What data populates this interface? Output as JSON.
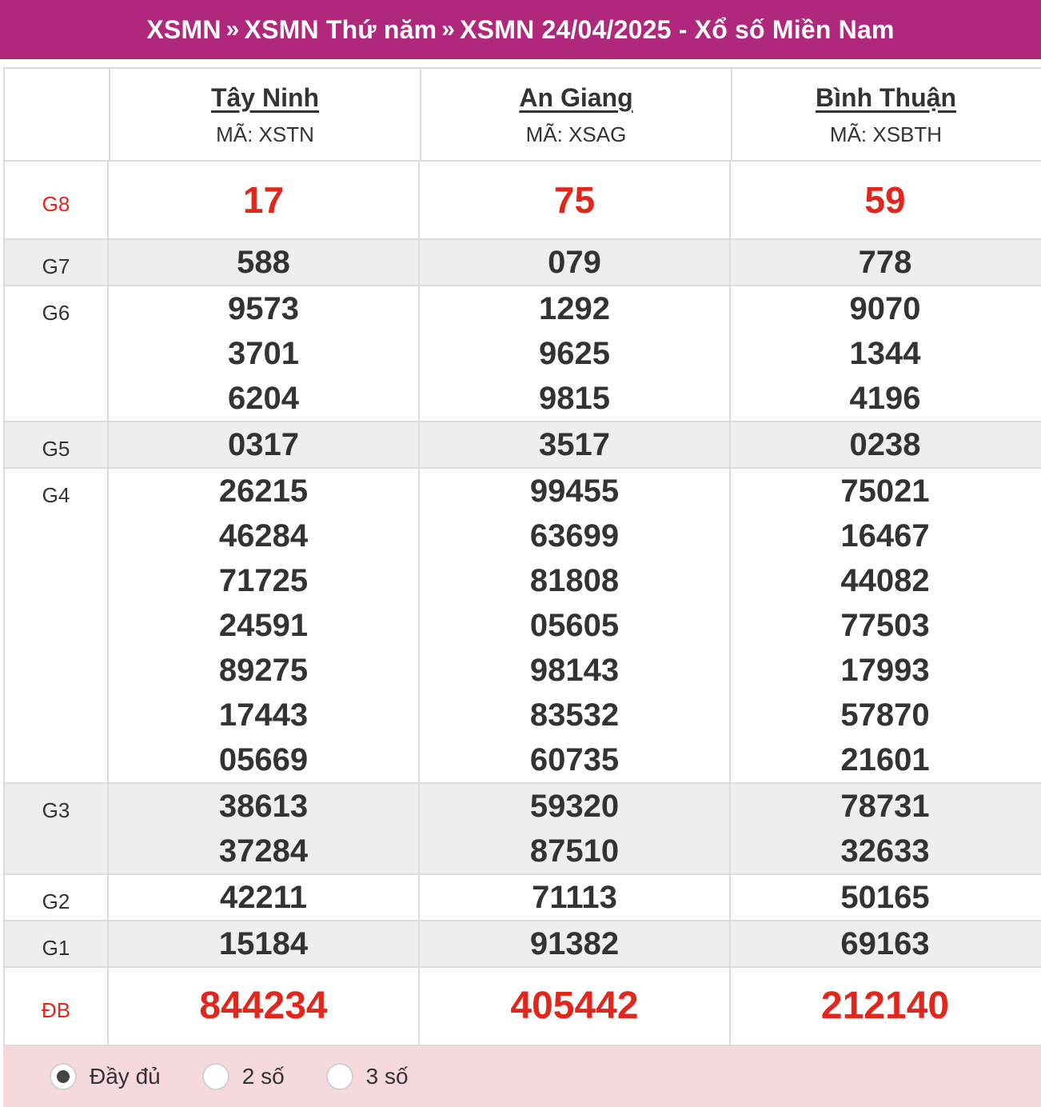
{
  "title": {
    "part1": "XSMN",
    "sep": "»",
    "part2": "XSMN Thứ năm",
    "part3": "XSMN 24/04/2025 - Xổ số Miền Nam"
  },
  "provinces": [
    {
      "name": "Tây Ninh",
      "code": "MÃ: XSTN"
    },
    {
      "name": "An Giang",
      "code": "MÃ: XSAG"
    },
    {
      "name": "Bình Thuận",
      "code": "MÃ: XSBTH"
    }
  ],
  "prizes": [
    {
      "label": "G8",
      "red": true,
      "shaded": false,
      "values": [
        [
          "17"
        ],
        [
          "75"
        ],
        [
          "59"
        ]
      ]
    },
    {
      "label": "G7",
      "red": false,
      "shaded": true,
      "values": [
        [
          "588"
        ],
        [
          "079"
        ],
        [
          "778"
        ]
      ]
    },
    {
      "label": "G6",
      "red": false,
      "shaded": false,
      "values": [
        [
          "9573",
          "3701",
          "6204"
        ],
        [
          "1292",
          "9625",
          "9815"
        ],
        [
          "9070",
          "1344",
          "4196"
        ]
      ]
    },
    {
      "label": "G5",
      "red": false,
      "shaded": true,
      "values": [
        [
          "0317"
        ],
        [
          "3517"
        ],
        [
          "0238"
        ]
      ]
    },
    {
      "label": "G4",
      "red": false,
      "shaded": false,
      "values": [
        [
          "26215",
          "46284",
          "71725",
          "24591",
          "89275",
          "17443",
          "05669"
        ],
        [
          "99455",
          "63699",
          "81808",
          "05605",
          "98143",
          "83532",
          "60735"
        ],
        [
          "75021",
          "16467",
          "44082",
          "77503",
          "17993",
          "57870",
          "21601"
        ]
      ]
    },
    {
      "label": "G3",
      "red": false,
      "shaded": true,
      "values": [
        [
          "38613",
          "37284"
        ],
        [
          "59320",
          "87510"
        ],
        [
          "78731",
          "32633"
        ]
      ]
    },
    {
      "label": "G2",
      "red": false,
      "shaded": false,
      "values": [
        [
          "42211"
        ],
        [
          "71113"
        ],
        [
          "50165"
        ]
      ]
    },
    {
      "label": "G1",
      "red": false,
      "shaded": true,
      "values": [
        [
          "15184"
        ],
        [
          "91382"
        ],
        [
          "69163"
        ]
      ]
    },
    {
      "label": "ĐB",
      "red": true,
      "shaded": false,
      "values": [
        [
          "844234"
        ],
        [
          "405442"
        ],
        [
          "212140"
        ]
      ]
    }
  ],
  "options": [
    {
      "label": "Đầy đủ",
      "checked": true
    },
    {
      "label": "2 số",
      "checked": false
    },
    {
      "label": "3 số",
      "checked": false
    }
  ],
  "colors": {
    "title_bg": "#b0287c",
    "prize_red": "#e3261b",
    "shaded_row": "#eeeeee",
    "footer_bg": "#f6d9dc"
  }
}
